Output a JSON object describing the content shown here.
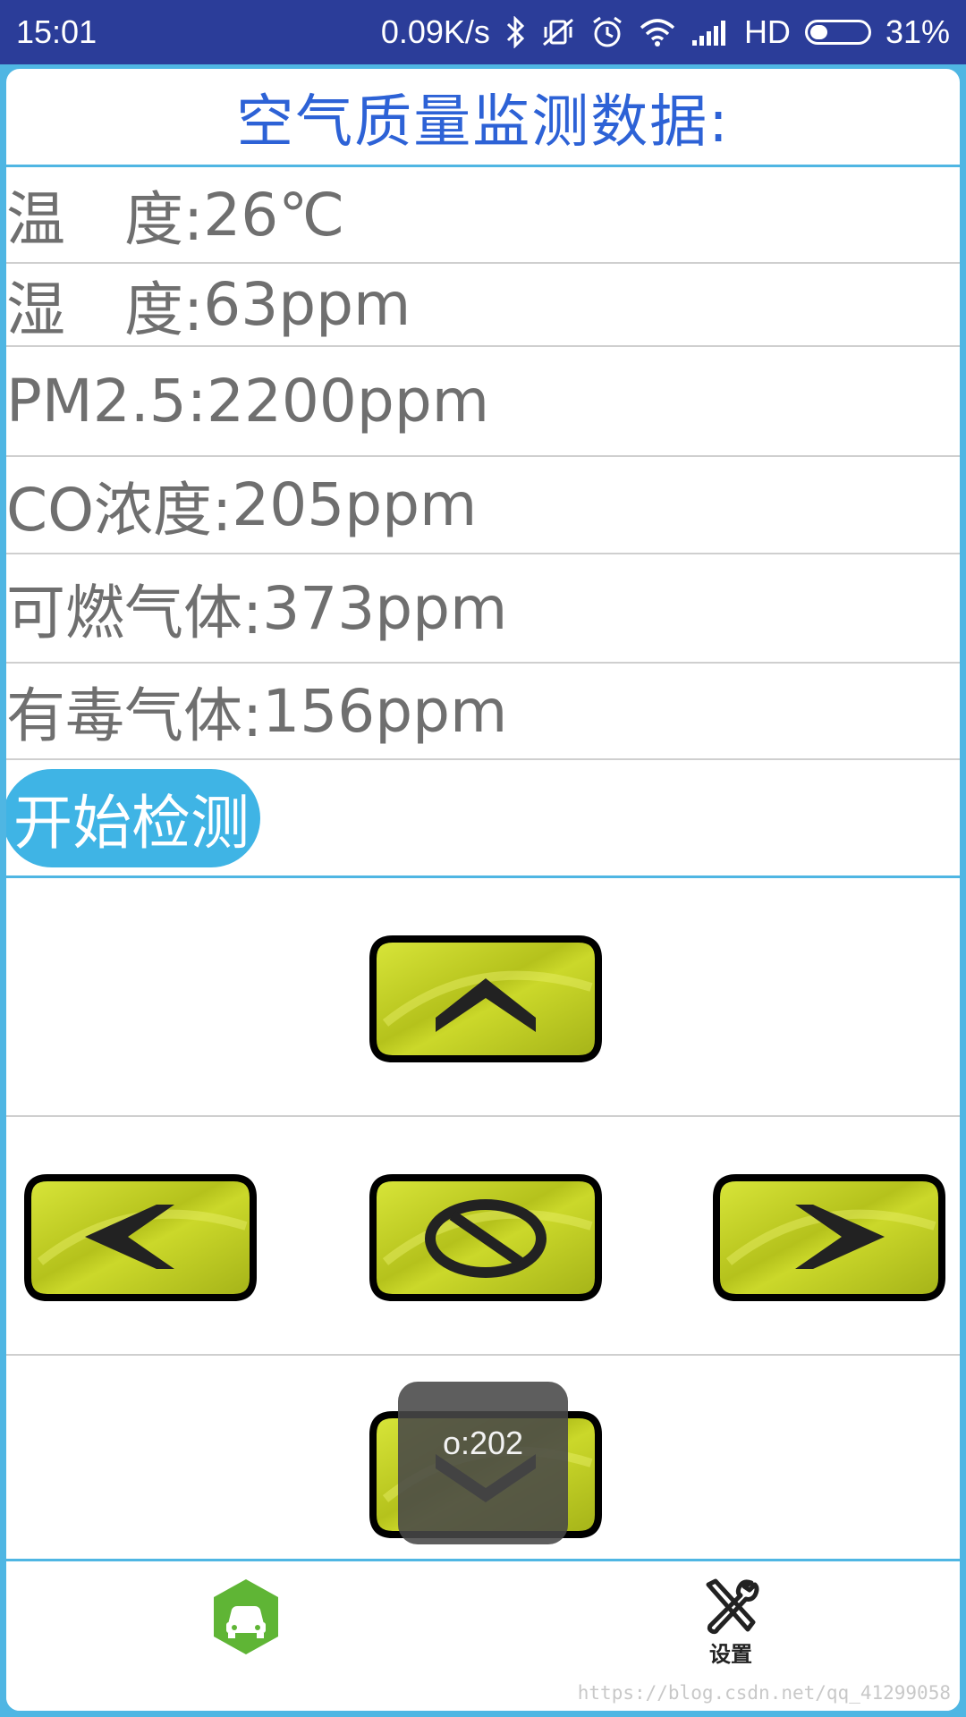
{
  "status_bar": {
    "time": "15:01",
    "network_speed": "0.09K/s",
    "signal_type": "HD",
    "battery_percent": "31%",
    "battery_level": 0.31,
    "icons": [
      "bluetooth-icon",
      "vibrate-off-icon",
      "alarm-icon",
      "wifi-icon",
      "cell-signal-icon",
      "battery-icon"
    ]
  },
  "screen": {
    "title": "空气质量监测数据:",
    "readings": [
      {
        "label": "温　度:",
        "value": "26℃"
      },
      {
        "label": "湿　度:",
        "value": "63ppm"
      },
      {
        "label": "PM2.5:",
        "value": "2200ppm"
      },
      {
        "label": "CO浓度:",
        "value": "205ppm"
      },
      {
        "label": "可燃气体:",
        "value": "373ppm"
      },
      {
        "label": "有毒气体:",
        "value": "156ppm"
      }
    ],
    "start_button_label": "开始检测"
  },
  "controls": {
    "icons": [
      "arrow-up-icon",
      "arrow-left-icon",
      "stop-icon",
      "arrow-right-icon",
      "arrow-down-icon"
    ]
  },
  "toast": {
    "text": "o:202"
  },
  "bottom_nav": {
    "car_icon": "car-icon",
    "settings_icon": "tools-icon",
    "settings_label": "设置"
  },
  "watermark": "https://blog.csdn.net/qq_41299058",
  "colors": {
    "status_bar": "#2b3d99",
    "accent": "#4fb6e3",
    "title": "#2d62d6",
    "button": "#3fb4e5",
    "pad_green": "#c8d41a",
    "nav_green": "#5fb535"
  }
}
